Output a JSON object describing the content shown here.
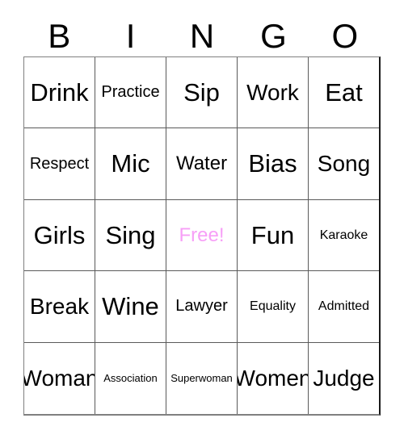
{
  "card": {
    "title": "BINGO",
    "header_letters": [
      "B",
      "I",
      "N",
      "G",
      "O"
    ],
    "free_space_color": "#f79ff7",
    "text_color": "#000000",
    "grid_line_color": "#5a5a5a",
    "background_color": "#ffffff",
    "rows": [
      [
        {
          "label": "Drink",
          "size": "sz-xl",
          "free": false
        },
        {
          "label": "Practice",
          "size": "sz-sm",
          "free": false
        },
        {
          "label": "Sip",
          "size": "sz-xl",
          "free": false
        },
        {
          "label": "Work",
          "size": "sz-lg",
          "free": false
        },
        {
          "label": "Eat",
          "size": "sz-xl",
          "free": false
        }
      ],
      [
        {
          "label": "Respect",
          "size": "sz-sm",
          "free": false
        },
        {
          "label": "Mic",
          "size": "sz-xl",
          "free": false
        },
        {
          "label": "Water",
          "size": "sz-md",
          "free": false
        },
        {
          "label": "Bias",
          "size": "sz-xl",
          "free": false
        },
        {
          "label": "Song",
          "size": "sz-lg",
          "free": false
        }
      ],
      [
        {
          "label": "Girls",
          "size": "sz-xl",
          "free": false
        },
        {
          "label": "Sing",
          "size": "sz-xl",
          "free": false
        },
        {
          "label": "Free!",
          "size": "sz-md",
          "free": true
        },
        {
          "label": "Fun",
          "size": "sz-xl",
          "free": false
        },
        {
          "label": "Karaoke",
          "size": "sz-xs",
          "free": false
        }
      ],
      [
        {
          "label": "Break",
          "size": "sz-lg",
          "free": false
        },
        {
          "label": "Wine",
          "size": "sz-xl",
          "free": false
        },
        {
          "label": "Lawyer",
          "size": "sz-sm",
          "free": false
        },
        {
          "label": "Equality",
          "size": "sz-xs",
          "free": false
        },
        {
          "label": "Admitted",
          "size": "sz-xs",
          "free": false
        }
      ],
      [
        {
          "label": "Woman",
          "size": "sz-lg",
          "free": false
        },
        {
          "label": "Association",
          "size": "sz-xxs",
          "free": false
        },
        {
          "label": "Superwoman",
          "size": "sz-xxs",
          "free": false
        },
        {
          "label": "Women",
          "size": "sz-lg",
          "free": false
        },
        {
          "label": "Judge",
          "size": "sz-lg",
          "free": false
        }
      ]
    ]
  }
}
